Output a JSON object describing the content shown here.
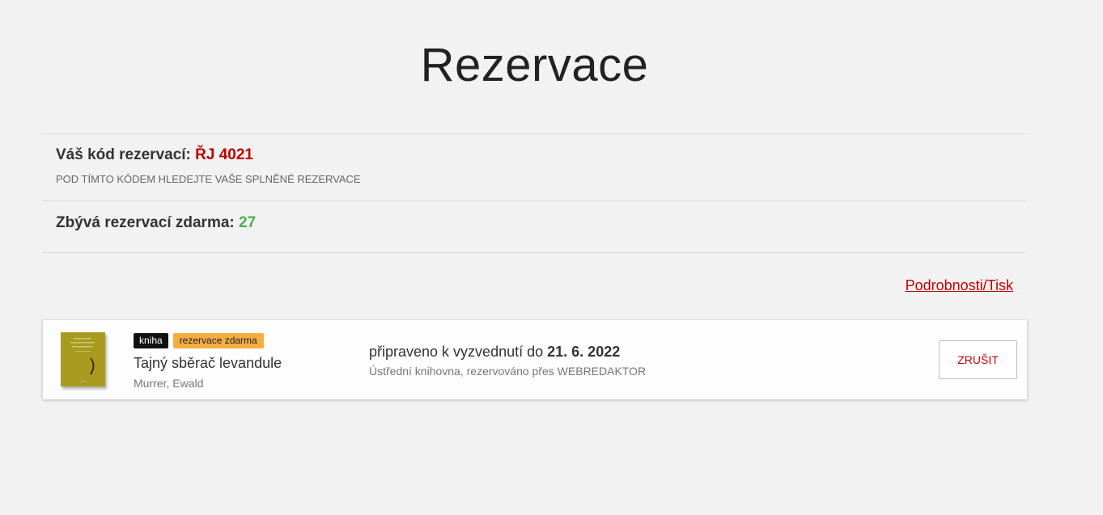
{
  "page": {
    "title": "Rezervace"
  },
  "reservation_code": {
    "label": "Váš kód rezervací:",
    "value": "ŘJ 4021",
    "note": "POD TÍMTO KÓDEM HLEDEJTE VAŠE SPLNĚNÉ REZERVACE"
  },
  "free_reservations": {
    "label": "Zbývá rezervací zdarma:",
    "value": "27"
  },
  "details_link": "Podrobnosti/Tisk",
  "reservations": [
    {
      "tag_type": "kniha",
      "tag_free": "rezervace zdarma",
      "title": "Tajný sběrač levandule",
      "author": "Murrer, Ewald",
      "status_prefix": "připraveno k vyzvednutí do",
      "status_date": "21. 6. 2022",
      "status_detail": "Ústřední knihovna, rezervováno přes WEBREDAKTOR",
      "cancel_label": "ZRUŠIT"
    }
  ],
  "colors": {
    "accent_red": "#c00000",
    "success_green": "#4caf50",
    "tag_orange": "#f5ad42",
    "cover_olive": "#a79a1e",
    "background": "#f2f2f2"
  }
}
